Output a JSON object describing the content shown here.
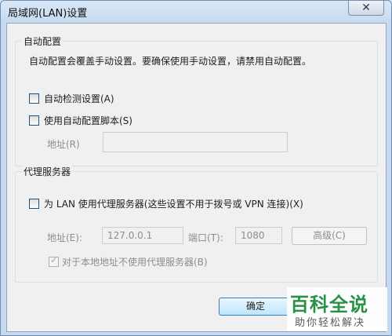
{
  "window": {
    "title": "局域网(LAN)设置",
    "close_label": "✕"
  },
  "auto_config": {
    "group_label": "自动配置",
    "description": "自动配置会覆盖手动设置。要确保使用手动设置，请禁用自动配置。",
    "auto_detect_label": "自动检测设置(A)",
    "auto_detect_checked": false,
    "script_label": "使用自动配置脚本(S)",
    "script_checked": false,
    "address_label": "地址(R)",
    "address_value": ""
  },
  "proxy": {
    "group_label": "代理服务器",
    "use_proxy_label": "为 LAN 使用代理服务器(这些设置不用于拨号或 VPN 连接)(X)",
    "use_proxy_checked": false,
    "address_label": "地址(E):",
    "address_value": "127.0.0.1",
    "port_label": "端口(T):",
    "port_value": "1080",
    "advanced_label": "高级(C)",
    "bypass_label": "对于本地地址不使用代理服务器(B)",
    "bypass_checked": true
  },
  "footer": {
    "ok_label": "确定"
  },
  "watermark": {
    "main": "百科全说",
    "sub": "助你轻松解决"
  }
}
